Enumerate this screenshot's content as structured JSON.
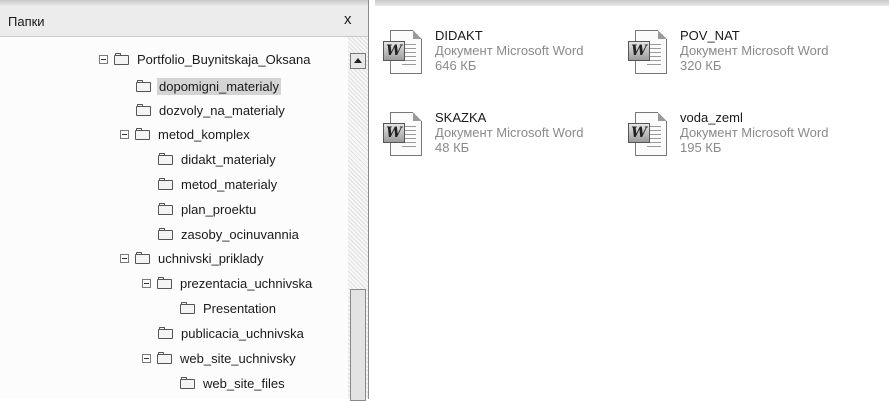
{
  "folders_pane": {
    "title": "Папки",
    "close_label": "x"
  },
  "tree": {
    "items": [
      {
        "label": "Portfolio_Buynitskaja_Oksana",
        "expanded": true,
        "selected": false
      },
      {
        "label": "dopomigni_materialy",
        "expanded": null,
        "selected": true
      },
      {
        "label": "dozvoly_na_materialy",
        "expanded": null,
        "selected": false
      },
      {
        "label": "metod_komplex",
        "expanded": true,
        "selected": false
      },
      {
        "label": "didakt_materialy",
        "expanded": null,
        "selected": false
      },
      {
        "label": "metod_materialy",
        "expanded": null,
        "selected": false
      },
      {
        "label": "plan_proektu",
        "expanded": null,
        "selected": false
      },
      {
        "label": "zasoby_ocinuvannia",
        "expanded": null,
        "selected": false
      },
      {
        "label": "uchnivski_priklady",
        "expanded": true,
        "selected": false
      },
      {
        "label": "prezentacia_uchnivska",
        "expanded": true,
        "selected": false
      },
      {
        "label": "Presentation",
        "expanded": null,
        "selected": false
      },
      {
        "label": "publicacia_uchnivska",
        "expanded": null,
        "selected": false
      },
      {
        "label": "web_site_uchnivsky",
        "expanded": true,
        "selected": false
      },
      {
        "label": "web_site_files",
        "expanded": null,
        "selected": false
      }
    ]
  },
  "files": [
    {
      "name": "DIDAKT",
      "type": "Документ Microsoft Word",
      "size": "646 КБ",
      "icon": "word-document-icon"
    },
    {
      "name": "POV_NAT",
      "type": "Документ Microsoft Word",
      "size": "320 КБ",
      "icon": "word-document-icon"
    },
    {
      "name": "SKAZKA",
      "type": "Документ Microsoft Word",
      "size": "48 КБ",
      "icon": "word-document-icon"
    },
    {
      "name": "voda_zeml",
      "type": "Документ Microsoft Word",
      "size": "195 КБ",
      "icon": "word-document-icon"
    }
  ]
}
